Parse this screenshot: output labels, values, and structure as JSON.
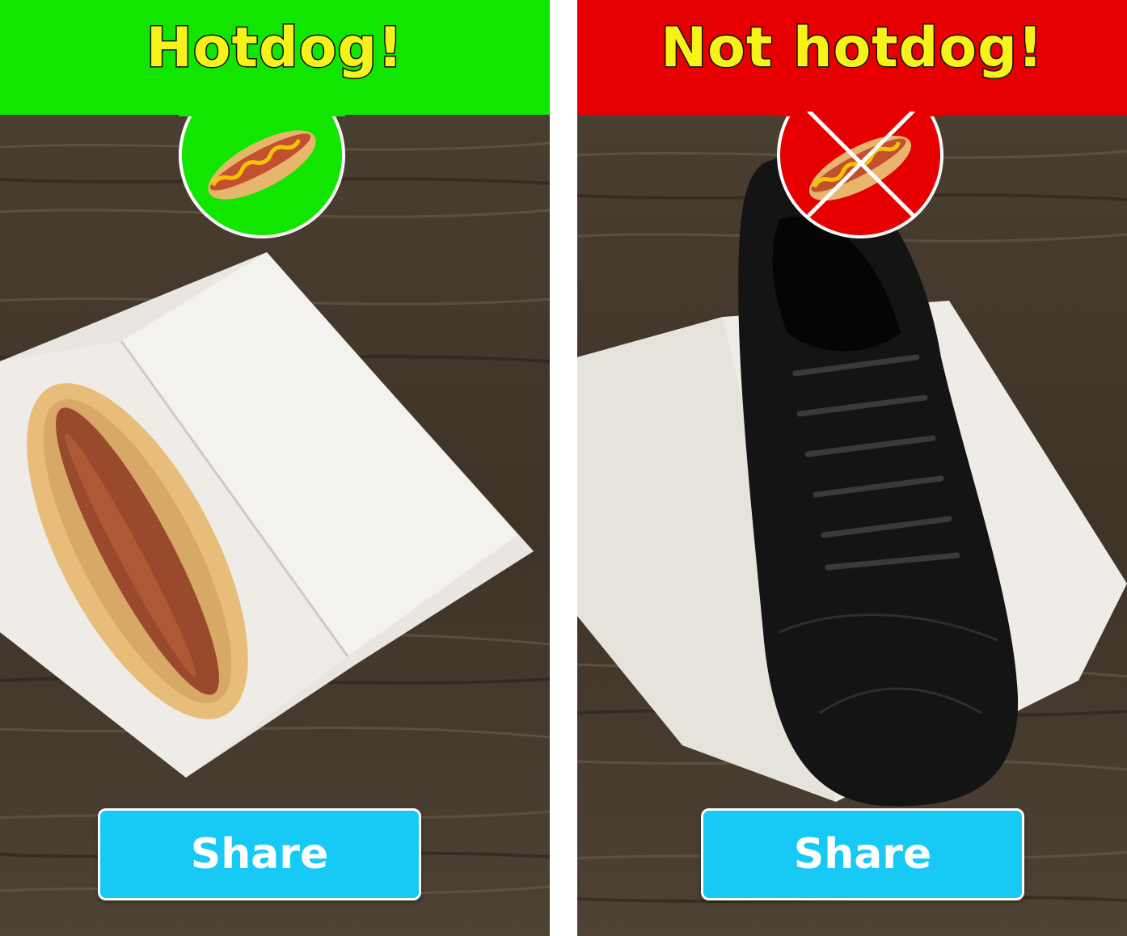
{
  "colors": {
    "hotdog_green": "#12e600",
    "not_hotdog_red": "#e60000",
    "title_yellow": "#f7f219",
    "share_blue": "#17c9f5"
  },
  "left_panel": {
    "title": "Hotdog!",
    "badge_icon": "hotdog-icon",
    "photo": "hotdog-in-paper-tray",
    "share_label": "Share"
  },
  "right_panel": {
    "title": "Not hotdog!",
    "badge_icon": "crossed-out-hotdog-icon",
    "photo": "black-shoe-in-paper-tray",
    "share_label": "Share"
  }
}
